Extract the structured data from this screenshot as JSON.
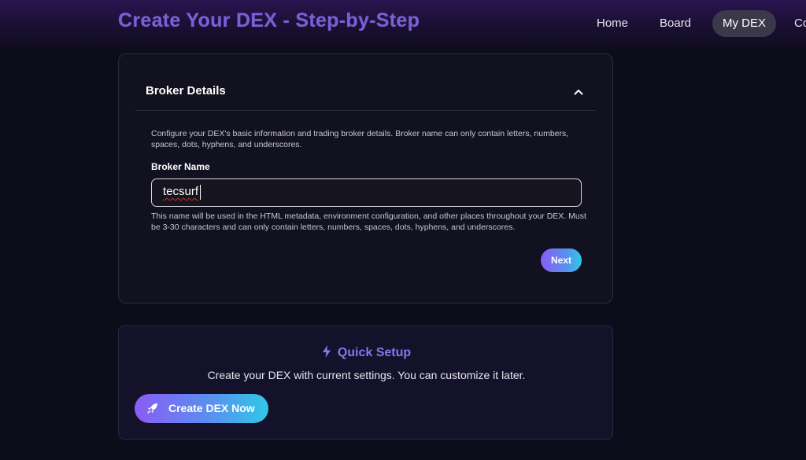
{
  "page": {
    "title": "Create Your DEX - Step-by-Step"
  },
  "nav": {
    "items": [
      {
        "label": "Home"
      },
      {
        "label": "Board"
      },
      {
        "label": "My DEX",
        "active": true
      },
      {
        "label": "Co"
      }
    ]
  },
  "broker_card": {
    "title": "Broker Details",
    "collapse_icon": "chevron-up-icon",
    "description": "Configure your DEX's basic information and trading broker details. Broker name can only contain letters, numbers, spaces, dots, hyphens, and underscores.",
    "field": {
      "label": "Broker Name",
      "value": "tecsurf",
      "hint": "This name will be used in the HTML metadata, environment configuration, and other places throughout your DEX. Must be 3-30 characters and can only contain letters, numbers, spaces, dots, hyphens, and underscores."
    },
    "next_label": "Next"
  },
  "quick_setup": {
    "icon": "lightning-icon",
    "title": "Quick Setup",
    "description": "Create your DEX with current settings. You can customize it later.",
    "button_icon": "rocket-icon",
    "button_label": "Create DEX Now"
  },
  "colors": {
    "accent_purple": "#8a5cf5",
    "accent_cyan": "#2fc8e8",
    "title_purple": "#7a5fd6",
    "background": "#0d0c1a"
  }
}
